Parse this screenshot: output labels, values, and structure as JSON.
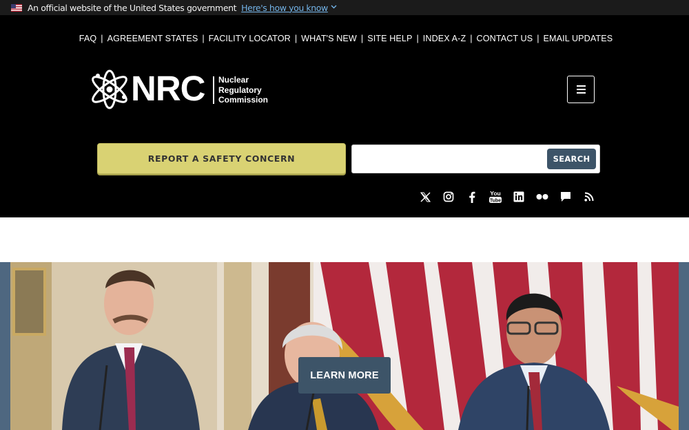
{
  "gov_banner": {
    "text": "An official website of the United States government",
    "link": "Here's how you know",
    "flag_icon": "us-flag-icon",
    "chevron_icon": "chevron-down-icon"
  },
  "utility_nav": [
    {
      "label": "FAQ"
    },
    {
      "label": "AGREEMENT STATES"
    },
    {
      "label": "FACILITY LOCATOR"
    },
    {
      "label": "WHAT'S NEW"
    },
    {
      "label": "SITE HELP"
    },
    {
      "label": "INDEX A-Z"
    },
    {
      "label": "CONTACT US"
    },
    {
      "label": "EMAIL UPDATES"
    }
  ],
  "logo": {
    "mark": "NRC",
    "line1": "Nuclear",
    "line2": "Regulatory",
    "line3": "Commission"
  },
  "menu_icon": "hamburger-menu-icon",
  "report_button": "REPORT A SAFETY CONCERN",
  "search": {
    "value": "",
    "placeholder": "",
    "button": "SEARCH"
  },
  "social_icons": [
    "x-icon",
    "instagram-icon",
    "facebook-icon",
    "youtube-icon",
    "linkedin-icon",
    "flickr-icon",
    "chat-icon",
    "rss-icon"
  ],
  "hero": {
    "button": "LEARN MORE"
  },
  "colors": {
    "gov_banner_bg": "#1b1b1b",
    "gov_link": "#73b3e7",
    "header_bg": "#000000",
    "report_button_bg": "#d9d273",
    "search_button_bg": "#3d5468",
    "learn_more_bg": "#3d5468",
    "hero_frame": "#4e6780"
  }
}
